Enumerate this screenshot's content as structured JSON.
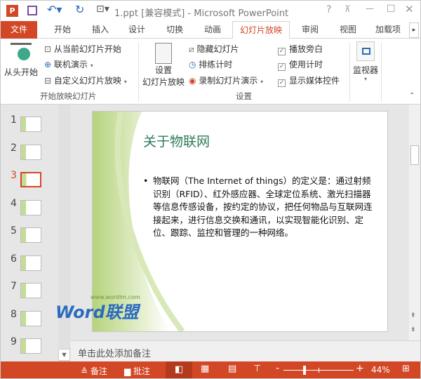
{
  "titlebar": {
    "title": "1.ppt [兼容模式] - Microsoft PowerPoint",
    "app_icon": "P"
  },
  "tabs": [
    "文件",
    "开始",
    "插入",
    "设计",
    "切换",
    "动画",
    "幻灯片放映",
    "审阅",
    "视图",
    "加载项"
  ],
  "ribbon": {
    "start": {
      "from_beginning": "从头开始",
      "from_current": "从当前幻灯片开始",
      "online": "联机演示",
      "custom": "自定义幻灯片放映",
      "group": "开始放映幻灯片"
    },
    "setup": {
      "setup_show": "设置",
      "setup_show2": "幻灯片放映",
      "hide": "隐藏幻灯片",
      "rehearse": "排练计时",
      "record": "录制幻灯片演示",
      "group": "设置"
    },
    "checks": [
      {
        "label": "播放旁白",
        "checked": true
      },
      {
        "label": "使用计时",
        "checked": true
      },
      {
        "label": "显示媒体控件",
        "checked": true
      }
    ],
    "monitors": {
      "label": "监视器"
    }
  },
  "thumbnails": [
    "1",
    "2",
    "3",
    "4",
    "5",
    "6",
    "7",
    "8",
    "9"
  ],
  "selected_slide": "3",
  "slide": {
    "title": "关于物联网",
    "bullet": "物联网（The Internet of things）的定义是：通过射频识别（RFID）、红外感应器、全球定位系统、激光扫描器等信息传感设备，按约定的协议，把任何物品与互联网连接起来，进行信息交换和通讯，以实现智能化识别、定位、跟踪、监控和管理的一种网络。",
    "watermark_url": "www.wordlm.com",
    "watermark": "Word联盟"
  },
  "notes": {
    "placeholder": "单击此处添加备注"
  },
  "status": {
    "notes": "备注",
    "comments": "批注",
    "zoom": "44%",
    "zoom_fraction": 0.3
  },
  "colors": {
    "accent": "#d24726"
  }
}
